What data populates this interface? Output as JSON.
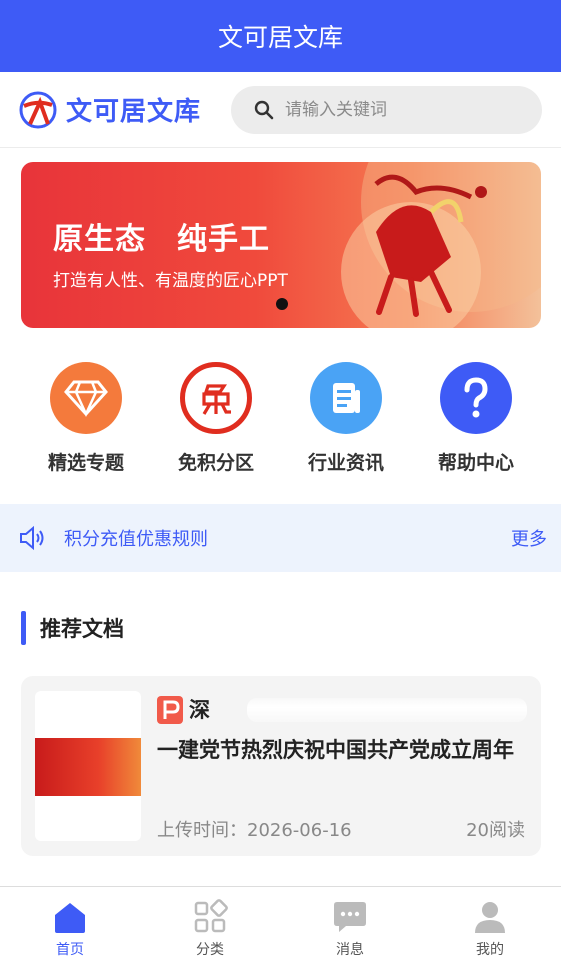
{
  "app": {
    "title": "文可居文库"
  },
  "header": {
    "brand": "文可居文库",
    "search_placeholder": "请输入关键词"
  },
  "banner": {
    "title": "原生态　纯手工",
    "subtitle": "打造有人性、有温度的匠心PPT"
  },
  "quick_links": [
    {
      "label": "精选专题",
      "icon": "diamond-icon",
      "color": "#f47a3c"
    },
    {
      "label": "免积分区",
      "icon": "free-icon",
      "color": "#e02d1f"
    },
    {
      "label": "行业资讯",
      "icon": "news-icon",
      "color": "#4aa3f5"
    },
    {
      "label": "帮助中心",
      "icon": "help-icon",
      "color": "#3e5bf6"
    }
  ],
  "notice": {
    "text": "积分充值优惠规则",
    "more": "更多"
  },
  "section": {
    "title": "推荐文档"
  },
  "doc": {
    "title_visible": "深",
    "title_line2": "一建党节热烈庆祝中国共产党成立周年",
    "upload_time": "上传时间：2026-06-16",
    "reads": "20阅读"
  },
  "tabs": [
    {
      "label": "首页",
      "icon": "home-icon",
      "active": true
    },
    {
      "label": "分类",
      "icon": "grid-icon",
      "active": false
    },
    {
      "label": "消息",
      "icon": "message-icon",
      "active": false
    },
    {
      "label": "我的",
      "icon": "user-icon",
      "active": false
    }
  ],
  "colors": {
    "primary": "#3e5bf6",
    "notice_bg": "#edf3fd",
    "banner_red": "#e8343a"
  }
}
